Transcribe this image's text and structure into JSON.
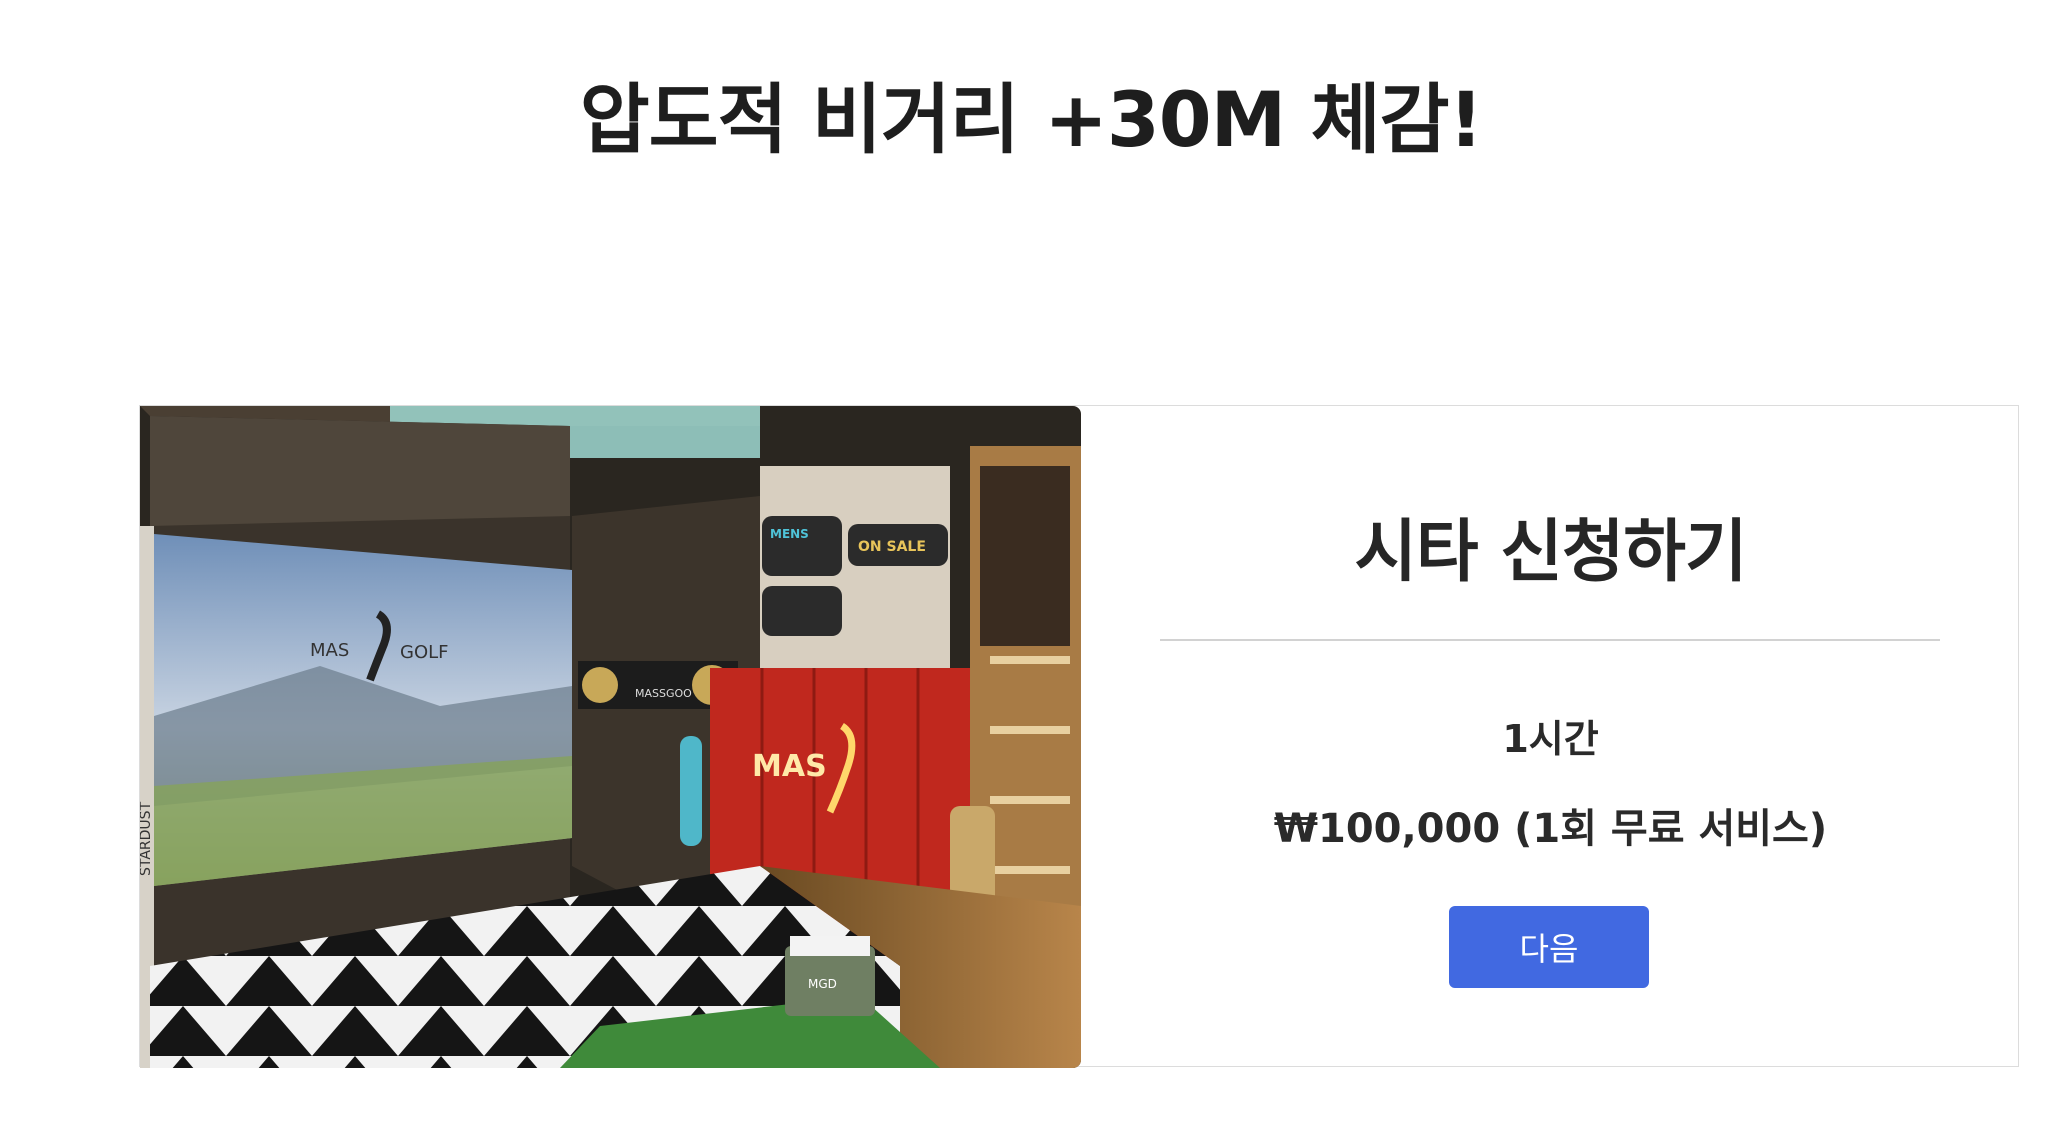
{
  "header": {
    "title": "압도적 비거리 +30M 체감!"
  },
  "card": {
    "image_alt": "MAS GOLF 스크린 골프 타석",
    "title": "시타 신청하기",
    "duration": "1시간",
    "price": "₩100,000 (1회 무료 서비스)",
    "next_label": "다음"
  },
  "photo_signage": {
    "screen_logo_left": "MAS",
    "screen_logo_right": "GOLF",
    "banner_text": "MASSGOO",
    "locker_logo": "MAS",
    "sign_mens": "MENS",
    "sign_onsale": "ON SALE",
    "side_text": "STARDUST",
    "ball_cart_text": "MGD"
  },
  "colors": {
    "accent_button": "#4169e1",
    "headline_text": "#1e1e1e",
    "card_border": "#dcdcdc"
  }
}
